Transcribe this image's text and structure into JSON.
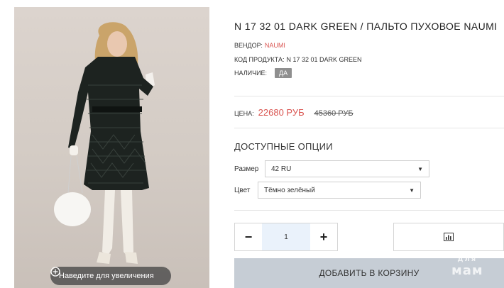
{
  "product": {
    "title": "N 17 32 01 DARK GREEN / ПАЛЬТО ПУХОВОЕ NAUMI",
    "vendor_label": "ВЕНДОР:",
    "vendor_value": "NAUMI",
    "code_label": "КОД ПРОДУКТА:",
    "code_value": "N 17 32 01 DARK GREEN",
    "stock_label": "НАЛИЧИЕ:",
    "stock_value": "ДА"
  },
  "price": {
    "label": "ЦЕНА:",
    "current": "22680 РУБ",
    "old": "45360 РУБ"
  },
  "options": {
    "title": "ДОСТУПНЫЕ ОПЦИИ",
    "size_label": "Размер",
    "size_value": "42 RU",
    "color_label": "Цвет",
    "color_value": "Тёмно зелёный"
  },
  "cart": {
    "qty_value": "1",
    "minus": "−",
    "plus": "+",
    "add_label": "ДОБАВИТЬ В КОРЗИНУ"
  },
  "image": {
    "zoom_hint": "Наведите для увеличения"
  },
  "watermark": {
    "top": "для",
    "bottom": "мам"
  },
  "colors": {
    "accent_red": "#d9534f",
    "stock_badge": "#8f8f8f",
    "cart_button": "#c6cdd5",
    "qty_input_bg": "#eaf2fb"
  },
  "icons": {
    "zoom": "plus-circle-icon",
    "compare": "bar-chart-icon",
    "select_arrow": "caret-down-icon"
  }
}
